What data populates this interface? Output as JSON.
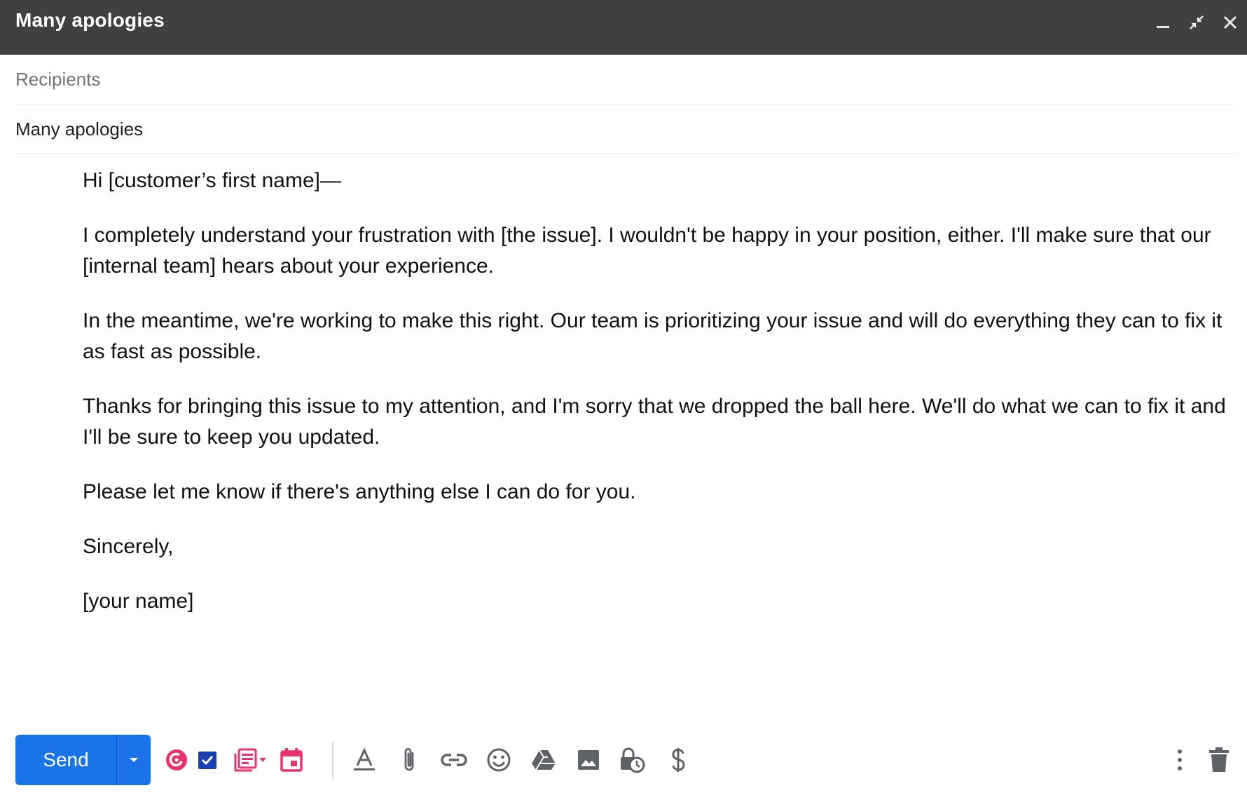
{
  "window": {
    "title": "Many apologies",
    "controls": [
      "minimize-icon",
      "exit-fullscreen-icon",
      "close-icon"
    ]
  },
  "compose": {
    "recipients_placeholder": "Recipients",
    "subject": "Many apologies",
    "body": {
      "greeting": "Hi [customer’s first name]—",
      "p1": "I completely understand your frustration with [the issue]. I wouldn't be happy in your position, either. I'll make sure that our [internal team] hears about your experience.",
      "p2": "In the meantime, we're working to make this right. Our team is prioritizing your issue and will do everything they can to fix it as fast as possible.",
      "p3": "Thanks for bringing this issue to my attention, and I'm sorry that we dropped the ball here. We'll do what we can to fix it and I'll be sure to keep you updated.",
      "p4": "Please let me know if there's anything else I can do for you.",
      "closing": "Sincerely,",
      "signature": "[your name]"
    }
  },
  "toolbar": {
    "send_label": "Send",
    "icons": [
      "boomerang-icon",
      "task-check-icon",
      "template-icon",
      "calendar-icon",
      "text-format-icon",
      "attachment-icon",
      "link-icon",
      "emoji-icon",
      "drive-icon",
      "image-icon",
      "confidential-mode-icon",
      "dollar-icon",
      "more-options-icon",
      "trash-icon"
    ]
  },
  "colors": {
    "titlebar": "#404040",
    "send_button": "#1a73e8",
    "icon_gray": "#5f6368",
    "icon_pink": "#e8336e",
    "icon_navy": "#1a3fb0"
  }
}
